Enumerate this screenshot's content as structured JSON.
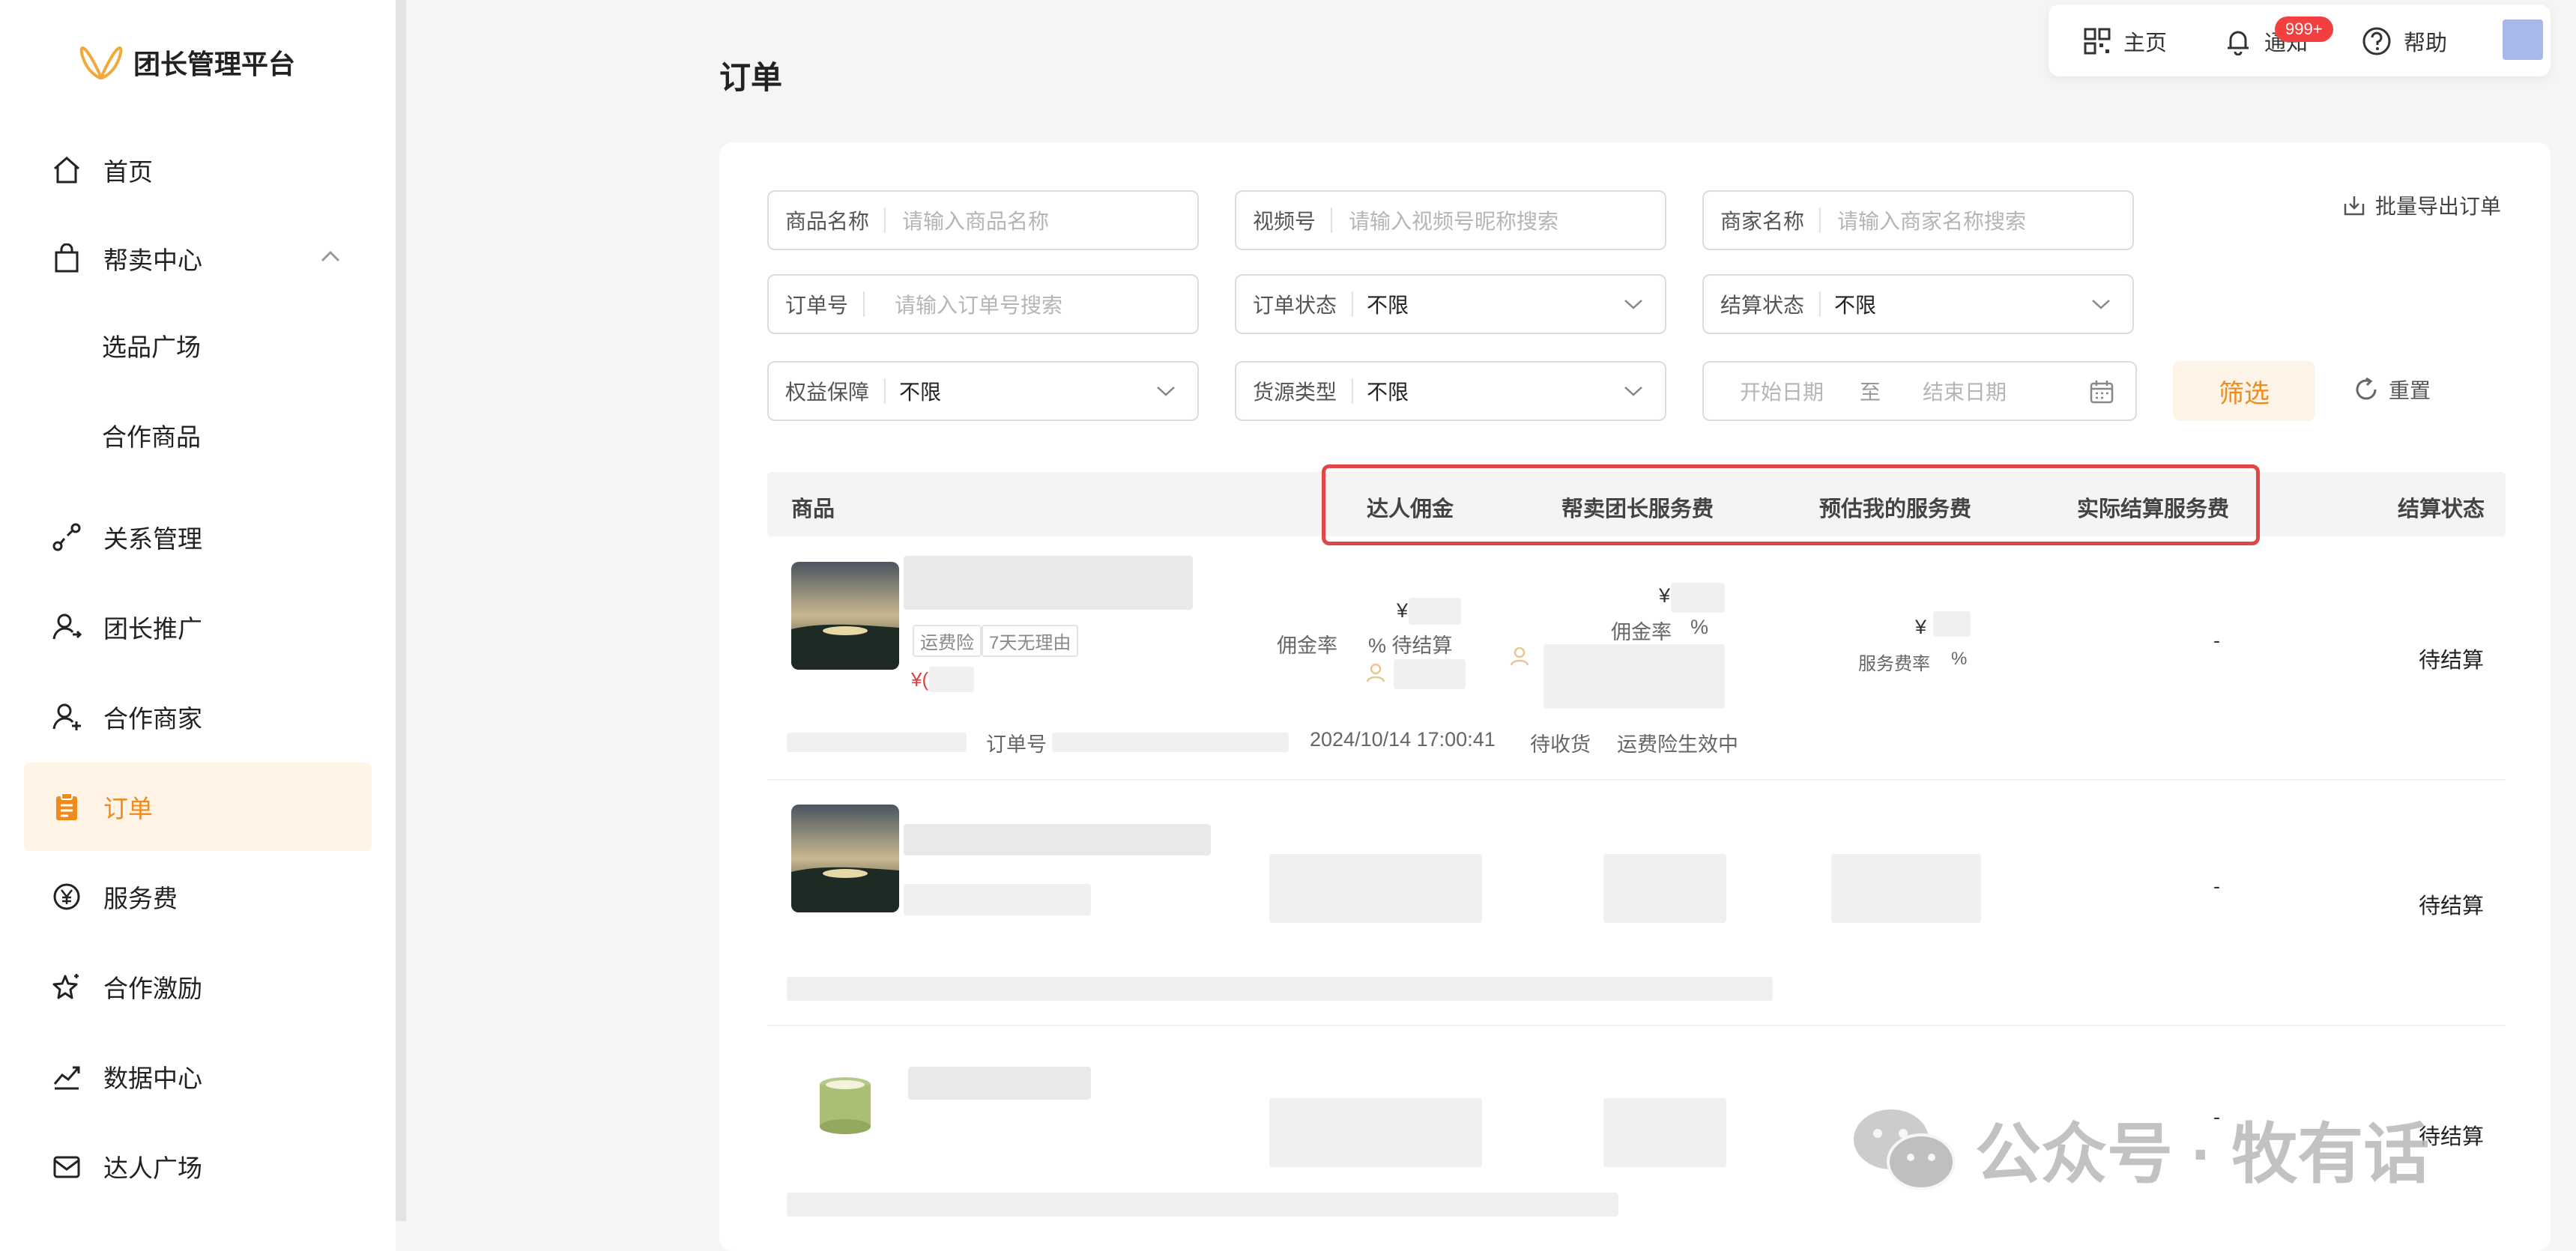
{
  "app": {
    "name": "团长管理平台"
  },
  "sidebar": {
    "items": [
      {
        "label": "首页"
      },
      {
        "label": "帮卖中心"
      },
      {
        "label": "选品广场"
      },
      {
        "label": "合作商品"
      },
      {
        "label": "关系管理"
      },
      {
        "label": "团长推广"
      },
      {
        "label": "合作商家"
      },
      {
        "label": "订单"
      },
      {
        "label": "服务费"
      },
      {
        "label": "合作激励"
      },
      {
        "label": "数据中心"
      },
      {
        "label": "达人广场"
      }
    ]
  },
  "toolbar": {
    "home": "主页",
    "notice": "通知",
    "notice_badge": "999+",
    "help": "帮助"
  },
  "page": {
    "title": "订单",
    "export": "批量导出订单"
  },
  "filters": {
    "product_name": {
      "label": "商品名称",
      "placeholder": "请输入商品名称"
    },
    "channel": {
      "label": "视频号",
      "placeholder": "请输入视频号昵称搜索"
    },
    "merchant": {
      "label": "商家名称",
      "placeholder": "请输入商家名称搜索"
    },
    "order_no": {
      "label": "订单号",
      "placeholder": "请输入订单号搜索"
    },
    "order_status": {
      "label": "订单状态",
      "value": "不限"
    },
    "settle_status": {
      "label": "结算状态",
      "value": "不限"
    },
    "guarantee": {
      "label": "权益保障",
      "value": "不限"
    },
    "source_type": {
      "label": "货源类型",
      "value": "不限"
    },
    "date": {
      "start": "开始日期",
      "sep": "至",
      "end": "结束日期"
    },
    "filter_btn": "筛选",
    "reset_btn": "重置"
  },
  "table": {
    "columns": [
      "商品",
      "达人佣金",
      "帮卖团长服务费",
      "预估我的服务费",
      "实际结算服务费",
      "结算状态"
    ],
    "rows": [
      {
        "tags": [
          "运费险",
          "7天无理由"
        ],
        "price_prefix": "¥(",
        "commission_yen": "¥(",
        "commission_rate": "佣金率",
        "commission_pct": "% 待结算",
        "leader_yen": "¥(",
        "leader_rate": "佣金率",
        "leader_pct": "%",
        "est_yen": "¥",
        "est_rate": "服务费率",
        "est_pct": "%",
        "actual": "-",
        "status": "待结算",
        "order_label": "订单号",
        "order_time": "2024/10/14 17:00:41",
        "order_state": "待收货",
        "insurance": "运费险生效中"
      },
      {
        "actual": "-",
        "status": "待结算"
      },
      {
        "actual": "-",
        "status": "待结算"
      }
    ]
  },
  "watermark": {
    "text": "公众号 · 牧有话"
  },
  "colors": {
    "accent": "#f08a1a",
    "highlight": "#e04646",
    "badge": "#f23f3f"
  }
}
